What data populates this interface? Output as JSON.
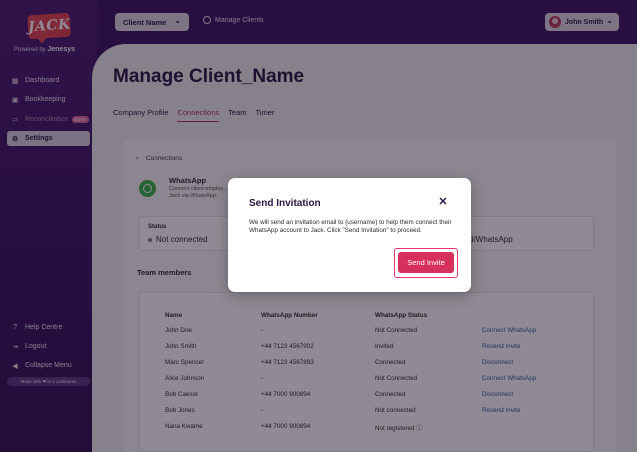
{
  "brand": {
    "logo_text": "JACK",
    "powered_prefix": "Powered by",
    "powered_brand": "Jenesys"
  },
  "sidebar": {
    "items": [
      {
        "label": "Dashboard",
        "icon": "grid-icon"
      },
      {
        "label": "Bookkeeping",
        "icon": "book-icon"
      },
      {
        "label": "Reconciliation",
        "icon": "reconcile-icon",
        "badge": "BETA",
        "disabled": true
      },
      {
        "label": "Settings",
        "icon": "gear-icon",
        "active": true
      }
    ],
    "bottom": [
      {
        "label": "Help Centre",
        "icon": "help-icon"
      },
      {
        "label": "Logout",
        "icon": "logout-icon"
      },
      {
        "label": "Collapse Menu",
        "icon": "collapse-icon"
      }
    ],
    "made_with": "Made with ❤ in 3 continents"
  },
  "topbar": {
    "client_select": "Client Name",
    "manage_clients": "Manage Clients",
    "user": "John Smith"
  },
  "main": {
    "title": "Manage Client_Name",
    "tabs": [
      "Company Profile",
      "Connections",
      "Team",
      "Timer"
    ],
    "active_tab": "Connections",
    "back_label": "Connections",
    "integration": {
      "name": "WhatsApp",
      "description": "Connect client employ... Jack via WhatsApp."
    },
    "status": {
      "label": "Status",
      "value": "Not connected",
      "link_fragment": "q-ltd/WhatsApp"
    },
    "team_title": "Team members",
    "table": {
      "headers": [
        "Name",
        "WhatsApp Number",
        "WhatsApp Status",
        ""
      ],
      "rows": [
        [
          "John Doe",
          "-",
          "Not Connected",
          "Connect WhatsApp"
        ],
        [
          "John Smith",
          "+44 7123 4567902",
          "Invited",
          "Resend Invite"
        ],
        [
          "Marc Spencer",
          "+44 7123 4567893",
          "Connected",
          "Disconnect"
        ],
        [
          "Alice Johnson",
          "-",
          "Not Connected",
          "Connect WhatsApp"
        ],
        [
          "Bob Caesor",
          "+44 7000 900894",
          "Connected",
          "Disconnect"
        ],
        [
          "Bob Jones",
          "-",
          "Not connected",
          "Resend Invite"
        ],
        [
          "Nana Kwame",
          "+44 7000 900894",
          "Not registered ⓘ",
          ""
        ]
      ]
    }
  },
  "modal": {
    "title": "Send Invitation",
    "close": "✕",
    "body": "We will send an invitation email to {username} to help them connect their WhatsApp account to Jack. Click \"Send Invitation\" to proceed.",
    "button": "Send Invite"
  },
  "colors": {
    "accent": "#d6305d",
    "sidebar": "#4a1b72",
    "link": "#2c5aa0"
  }
}
